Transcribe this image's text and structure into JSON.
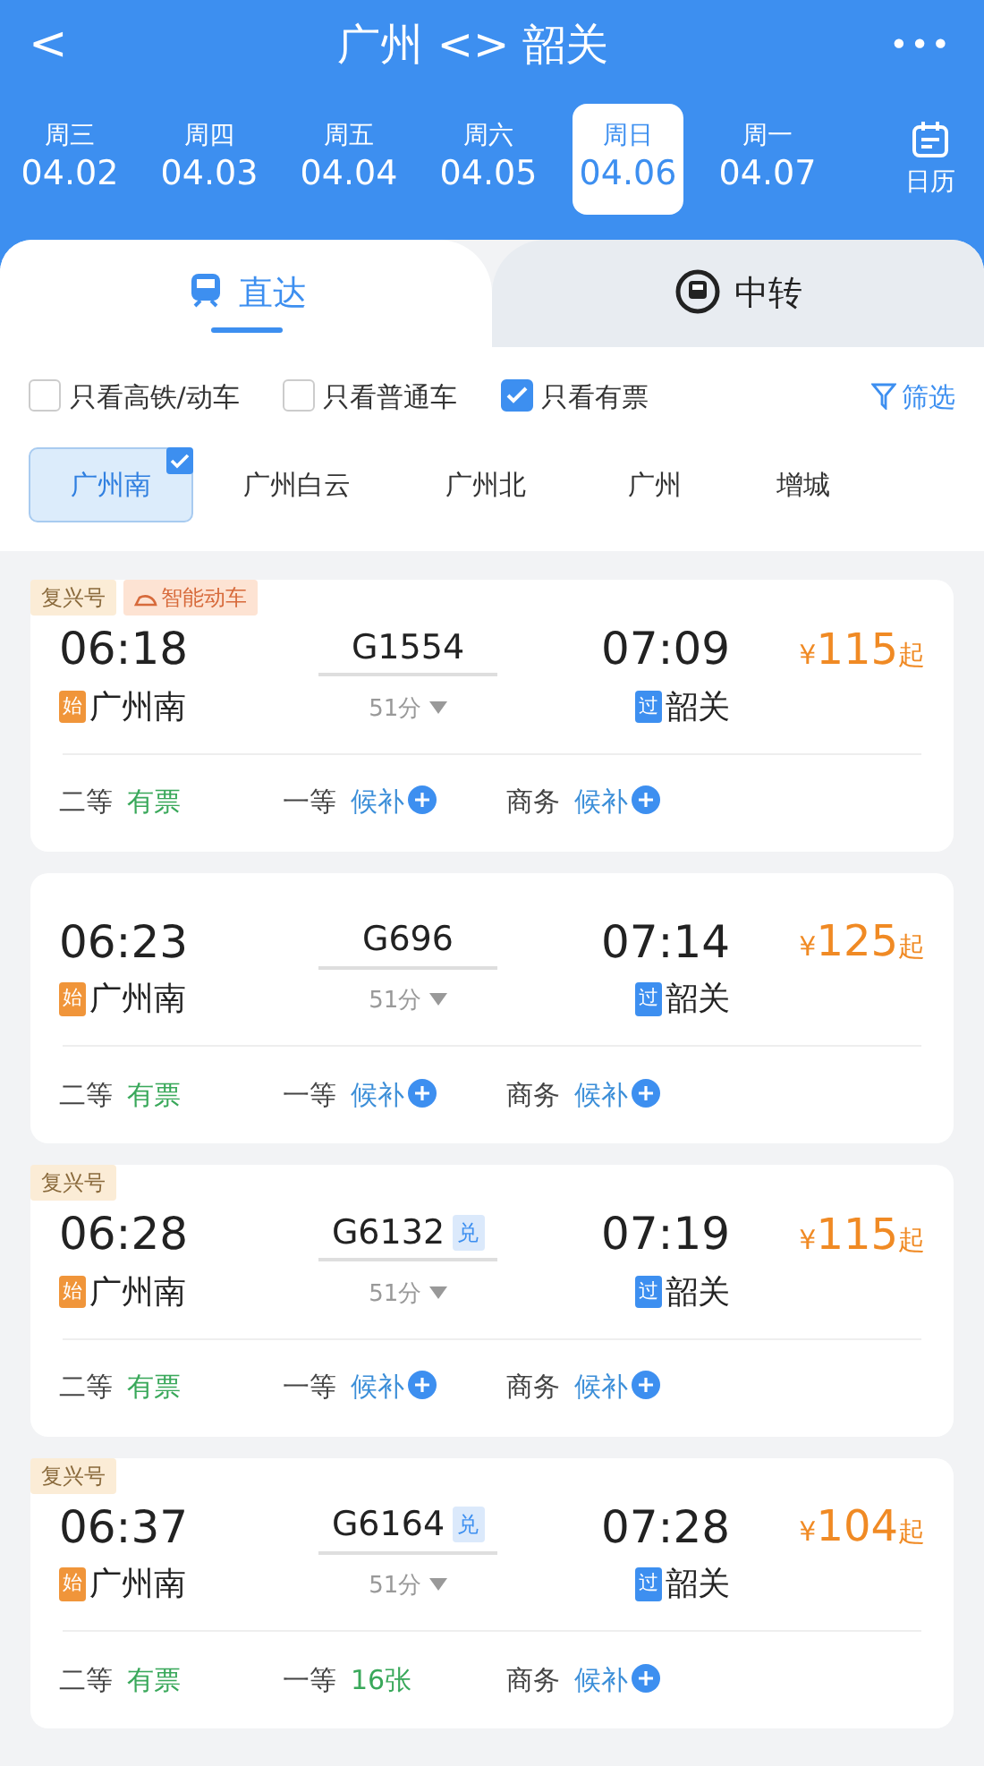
{
  "header": {
    "back": "<",
    "title": "广州 <> 韶关",
    "more": "•••"
  },
  "dates": [
    {
      "weekday": "周三",
      "date": "04.02",
      "selected": false
    },
    {
      "weekday": "周四",
      "date": "04.03",
      "selected": false
    },
    {
      "weekday": "周五",
      "date": "04.04",
      "selected": false
    },
    {
      "weekday": "周六",
      "date": "04.05",
      "selected": false
    },
    {
      "weekday": "周日",
      "date": "04.06",
      "selected": true
    },
    {
      "weekday": "周一",
      "date": "04.07",
      "selected": false
    }
  ],
  "calendar_label": "日历",
  "modes": [
    {
      "label": "直达",
      "kind": "direct",
      "selected": true
    },
    {
      "label": "中转",
      "kind": "transfer",
      "selected": false
    }
  ],
  "filters": [
    {
      "label": "只看高铁/动车",
      "checked": false
    },
    {
      "label": "只看普通车",
      "checked": false
    },
    {
      "label": "只看有票",
      "checked": true
    }
  ],
  "filter_button": "筛选",
  "stations": [
    {
      "label": "广州南",
      "selected": true
    },
    {
      "label": "广州白云",
      "selected": false
    },
    {
      "label": "广州北",
      "selected": false
    },
    {
      "label": "广州",
      "selected": false
    },
    {
      "label": "增城",
      "selected": false
    }
  ],
  "trains": [
    {
      "tags": [
        {
          "label": "复兴号",
          "kind": "fuxing"
        },
        {
          "label": "智能动车",
          "kind": "smart"
        }
      ],
      "depart": "06:18",
      "number": "G1554",
      "arrive": "07:09",
      "price_symbol": "¥",
      "price": "115",
      "price_suffix": "起",
      "from_mark": "始",
      "from": "广州南",
      "duration": "51分",
      "to_mark": "过",
      "to": "韶关",
      "seats": [
        {
          "class": "二等",
          "status": "有票",
          "kind": "available"
        },
        {
          "class": "一等",
          "status": "候补",
          "kind": "waitlist"
        },
        {
          "class": "商务",
          "status": "候补",
          "kind": "waitlist"
        }
      ]
    },
    {
      "depart": "06:23",
      "number": "G696",
      "arrive": "07:14",
      "price_symbol": "¥",
      "price": "125",
      "price_suffix": "起",
      "from_mark": "始",
      "from": "广州南",
      "duration": "51分",
      "to_mark": "过",
      "to": "韶关",
      "seats": [
        {
          "class": "二等",
          "status": "有票",
          "kind": "available"
        },
        {
          "class": "一等",
          "status": "候补",
          "kind": "waitlist"
        },
        {
          "class": "商务",
          "status": "候补",
          "kind": "waitlist"
        }
      ]
    },
    {
      "tags": [
        {
          "label": "复兴号",
          "kind": "fuxing"
        }
      ],
      "depart": "06:28",
      "number": "G6132",
      "number_tag": "兑",
      "arrive": "07:19",
      "price_symbol": "¥",
      "price": "115",
      "price_suffix": "起",
      "from_mark": "始",
      "from": "广州南",
      "duration": "51分",
      "to_mark": "过",
      "to": "韶关",
      "seats": [
        {
          "class": "二等",
          "status": "有票",
          "kind": "available"
        },
        {
          "class": "一等",
          "status": "候补",
          "kind": "waitlist"
        },
        {
          "class": "商务",
          "status": "候补",
          "kind": "waitlist"
        }
      ]
    },
    {
      "tags": [
        {
          "label": "复兴号",
          "kind": "fuxing"
        }
      ],
      "depart": "06:37",
      "number": "G6164",
      "number_tag": "兑",
      "arrive": "07:28",
      "price_symbol": "¥",
      "price": "104",
      "price_suffix": "起",
      "from_mark": "始",
      "from": "广州南",
      "duration": "51分",
      "to_mark": "过",
      "to": "韶关",
      "seats": [
        {
          "class": "二等",
          "status": "有票",
          "kind": "available"
        },
        {
          "class": "一等",
          "status": "16张",
          "kind": "available"
        },
        {
          "class": "商务",
          "status": "候补",
          "kind": "waitlist"
        }
      ]
    }
  ]
}
